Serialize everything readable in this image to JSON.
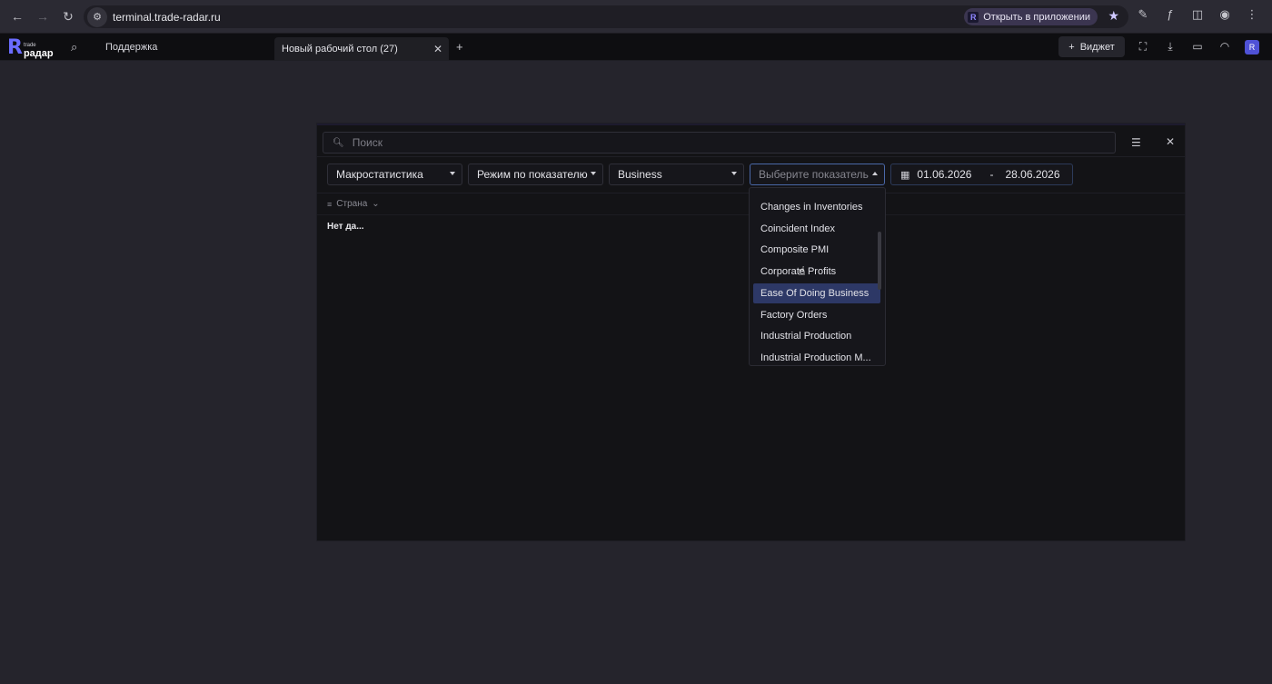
{
  "browser": {
    "url": "terminal.trade-radar.ru",
    "open_in_app_label": "Открыть в приложении"
  },
  "app": {
    "logo_letter": "R",
    "logo_small": "trade",
    "logo_brand": "радар",
    "support_label": "Поддержка",
    "tab_label": "Новый рабочий стол (27)",
    "widget_label": "Виджет"
  },
  "panel": {
    "search_placeholder": "Поиск",
    "filters": {
      "category": "Макростатистика",
      "mode": "Режим по показателю",
      "group": "Business",
      "indicator_placeholder": "Выберите показатель"
    },
    "date_from": "01.06.2026",
    "date_sep": "-",
    "date_to": "28.06.2026",
    "column_header": "Страна",
    "no_data": "Нет да..."
  },
  "dropdown": {
    "items": [
      "Changes in Inventories",
      "Coincident Index",
      "Composite PMI",
      "Corporate Profits",
      "Ease Of Doing Business",
      "Factory Orders",
      "Industrial Production",
      "Industrial Production M..."
    ],
    "highlighted": "Ease Of Doing Business"
  }
}
